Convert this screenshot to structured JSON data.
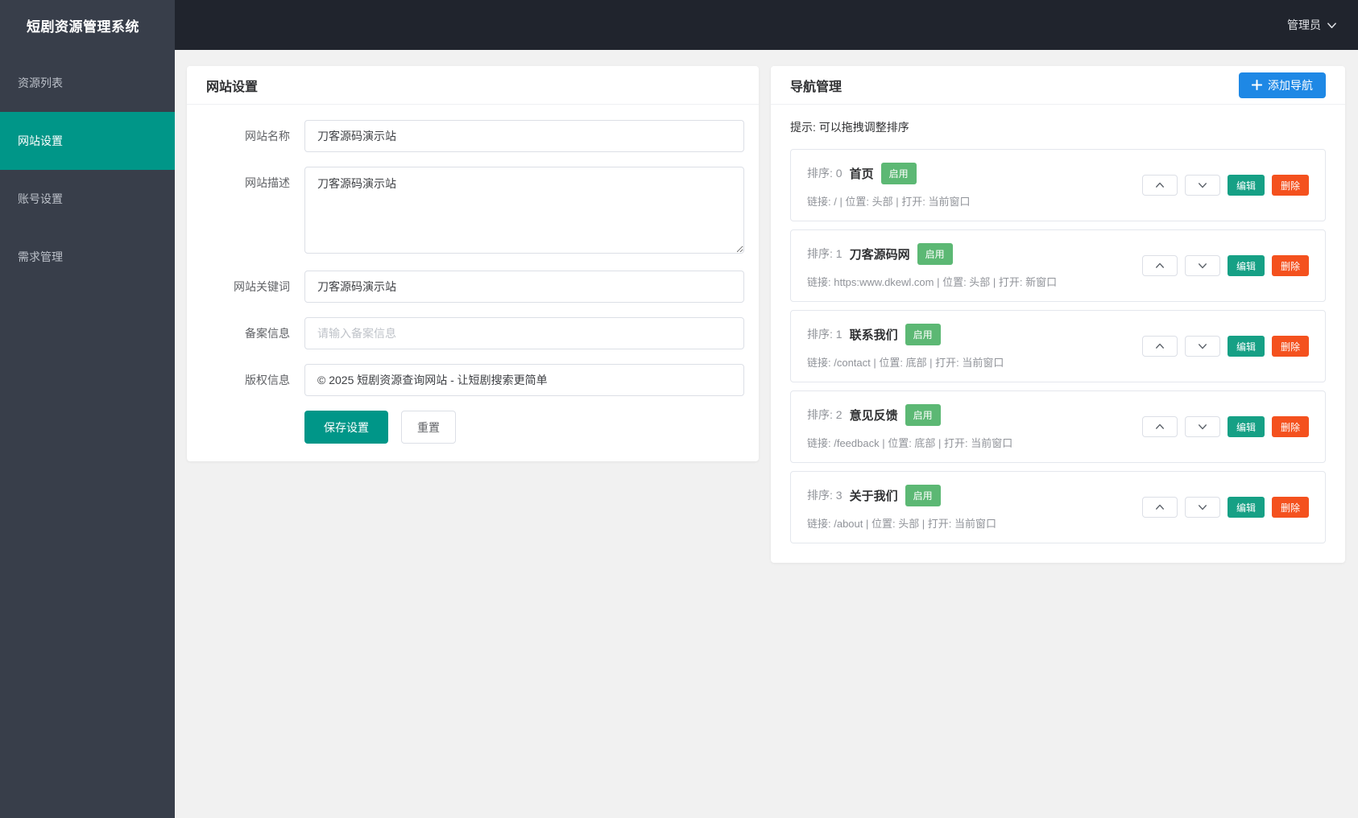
{
  "app": {
    "logo": "短剧资源管理系统",
    "user": "管理员"
  },
  "sidebar": {
    "items": [
      {
        "label": "资源列表",
        "active": false
      },
      {
        "label": "网站设置",
        "active": true
      },
      {
        "label": "账号设置",
        "active": false
      },
      {
        "label": "需求管理",
        "active": false
      }
    ]
  },
  "site_settings": {
    "title": "网站设置",
    "fields": [
      {
        "label": "网站名称",
        "value": "刀客源码演示站",
        "placeholder": ""
      },
      {
        "label": "网站描述",
        "value": "刀客源码演示站",
        "placeholder": ""
      },
      {
        "label": "网站关键词",
        "value": "刀客源码演示站",
        "placeholder": ""
      },
      {
        "label": "备案信息",
        "value": "",
        "placeholder": "请输入备案信息"
      },
      {
        "label": "版权信息",
        "value": "© 2025 短剧资源查询网站 - 让短剧搜索更简单",
        "placeholder": ""
      }
    ],
    "save_label": "保存设置",
    "reset_label": "重置"
  },
  "nav_mgmt": {
    "title": "导航管理",
    "add_label": "添加导航",
    "hint": "提示: 可以拖拽调整排序",
    "edit_label": "编辑",
    "delete_label": "删除",
    "items": [
      {
        "order_label": "排序: 0",
        "name": "首页",
        "status": "启用",
        "meta": "链接: / | 位置: 头部 | 打开: 当前窗口"
      },
      {
        "order_label": "排序: 1",
        "name": "刀客源码网",
        "status": "启用",
        "meta": "链接: https:www.dkewl.com | 位置: 头部 | 打开: 新窗口"
      },
      {
        "order_label": "排序: 1",
        "name": "联系我们",
        "status": "启用",
        "meta": "链接: /contact | 位置: 底部 | 打开: 当前窗口"
      },
      {
        "order_label": "排序: 2",
        "name": "意见反馈",
        "status": "启用",
        "meta": "链接: /feedback | 位置: 底部 | 打开: 当前窗口"
      },
      {
        "order_label": "排序: 3",
        "name": "关于我们",
        "status": "启用",
        "meta": "链接: /about | 位置: 头部 | 打开: 当前窗口"
      }
    ]
  },
  "colors": {
    "sidebar_bg": "#383e4a",
    "topbar_bg": "#20242d",
    "active_teal": "#009688",
    "add_button_blue": "#1e88e5",
    "enabled_badge_green": "#5cb874",
    "edit_teal": "#16a085",
    "delete_red": "#f4511e",
    "page_bg": "#f1f1f1"
  }
}
